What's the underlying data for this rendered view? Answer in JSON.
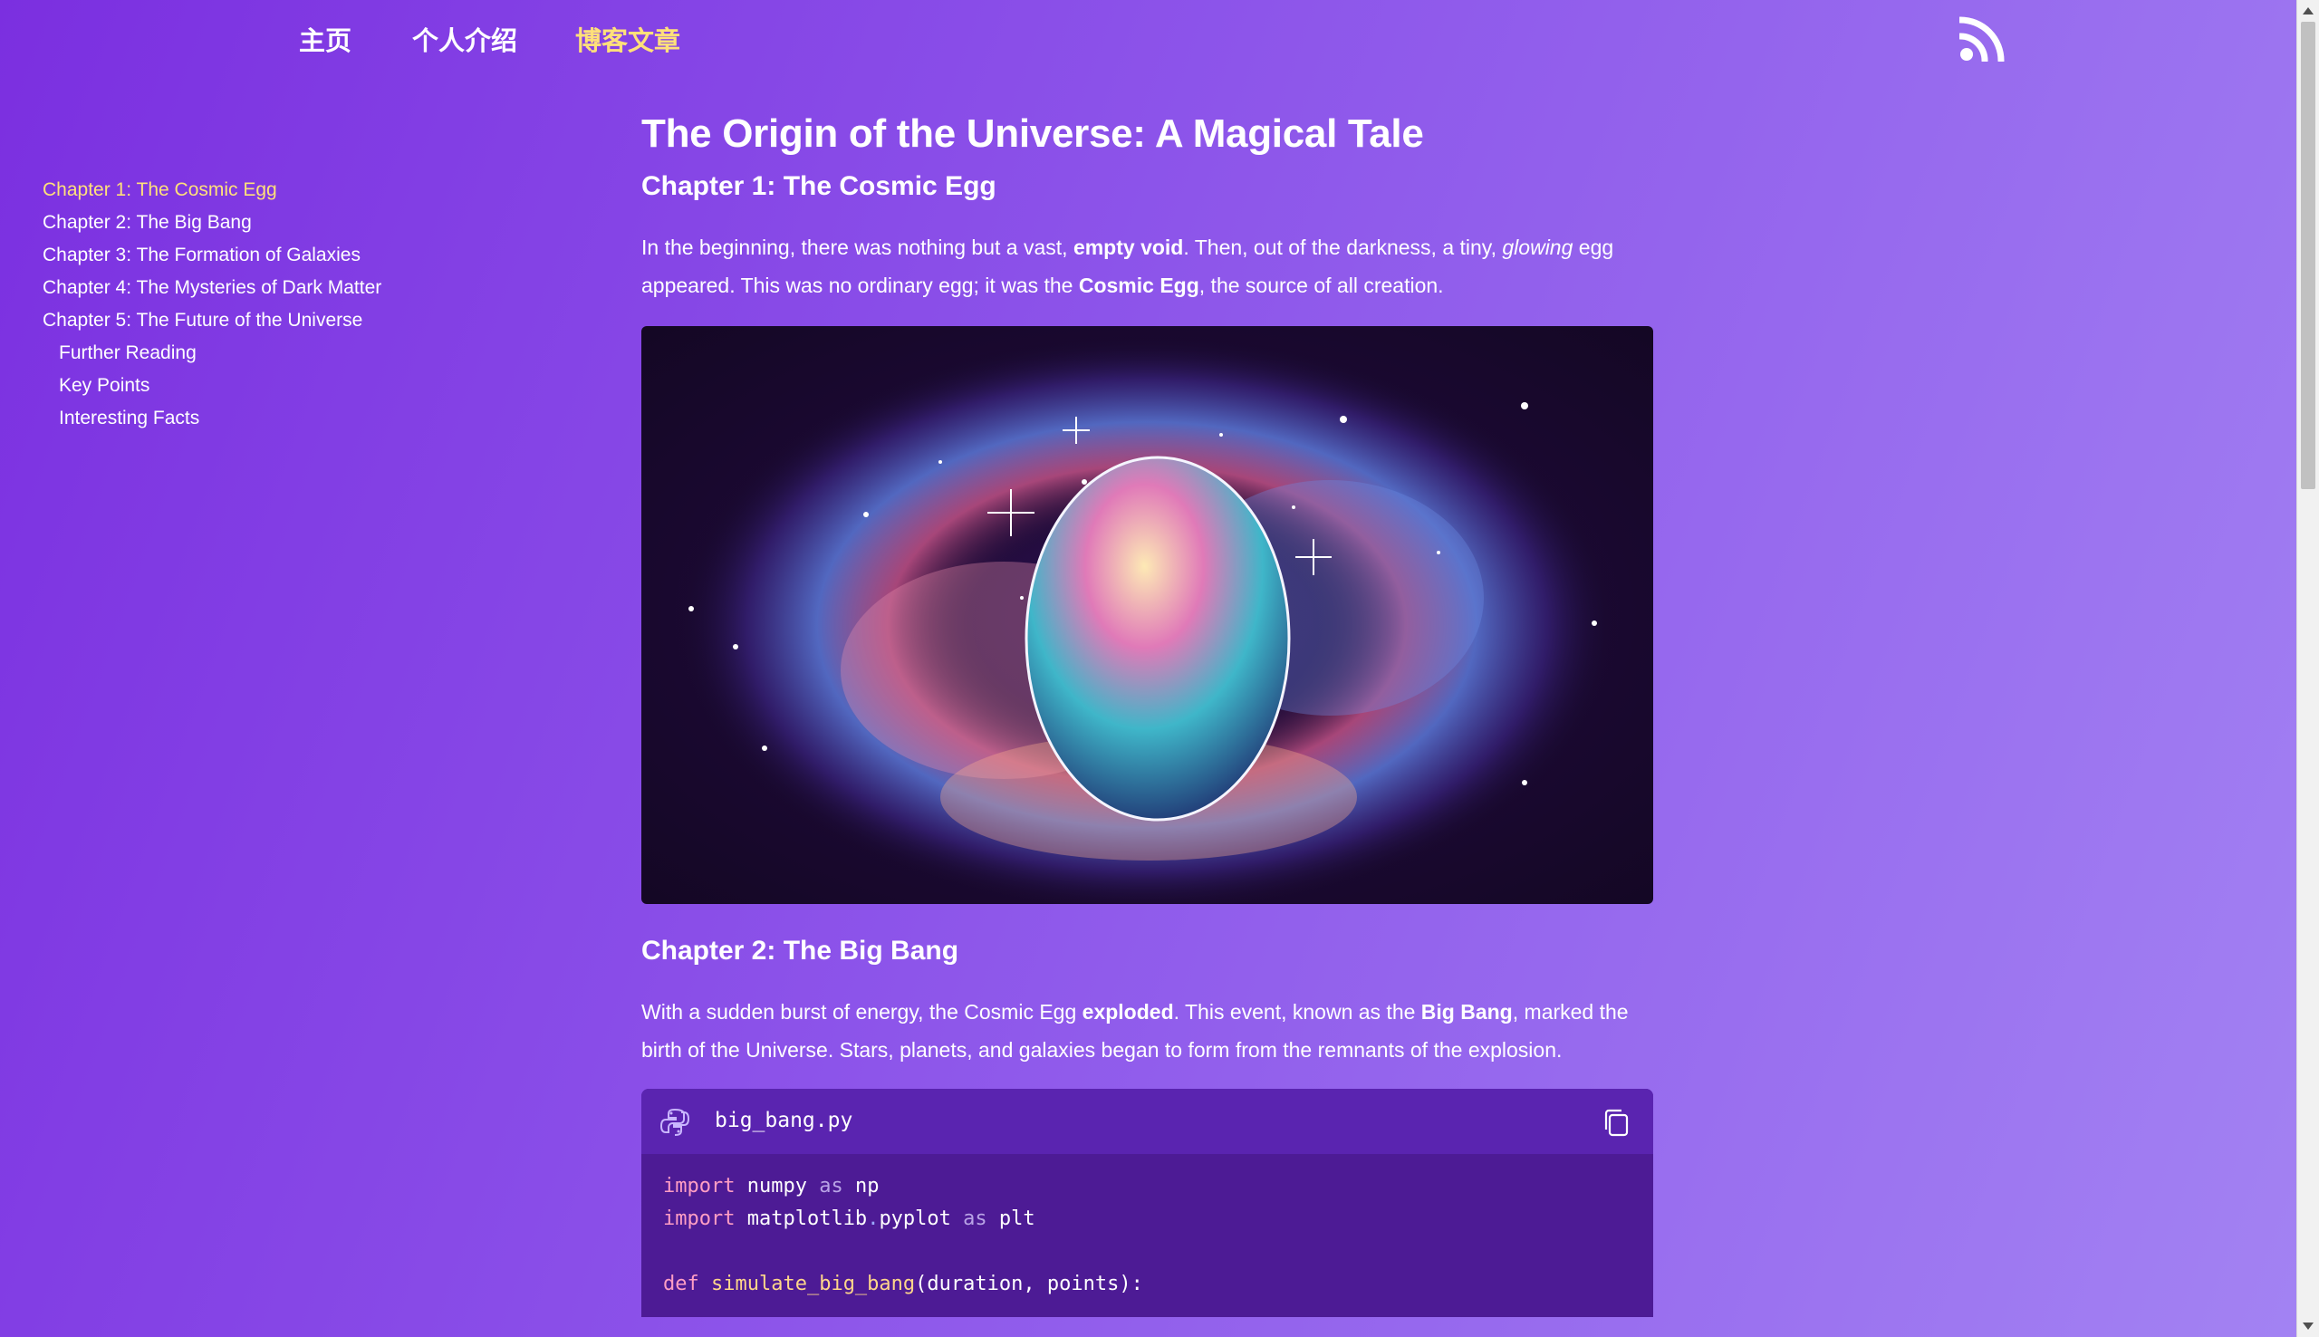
{
  "nav": {
    "items": [
      {
        "label": "主页",
        "active": false
      },
      {
        "label": "个人介绍",
        "active": false
      },
      {
        "label": "博客文章",
        "active": true
      }
    ],
    "rss_icon": "rss-icon"
  },
  "toc": {
    "items": [
      {
        "label": "Chapter 1: The Cosmic Egg",
        "active": true,
        "sub": false
      },
      {
        "label": "Chapter 2: The Big Bang",
        "active": false,
        "sub": false
      },
      {
        "label": "Chapter 3: The Formation of Galaxies",
        "active": false,
        "sub": false
      },
      {
        "label": "Chapter 4: The Mysteries of Dark Matter",
        "active": false,
        "sub": false
      },
      {
        "label": "Chapter 5: The Future of the Universe",
        "active": false,
        "sub": false
      },
      {
        "label": "Further Reading",
        "active": false,
        "sub": true
      },
      {
        "label": "Key Points",
        "active": false,
        "sub": true
      },
      {
        "label": "Interesting Facts",
        "active": false,
        "sub": true
      }
    ]
  },
  "article": {
    "title": "The Origin of the Universe: A Magical Tale",
    "ch1": {
      "heading": "Chapter 1: The Cosmic Egg",
      "p1_a": "In the beginning, there was nothing but a vast, ",
      "p1_b": "empty void",
      "p1_c": ". Then, out of the darkness, a tiny, ",
      "p1_d": "glowing",
      "p1_e": " egg appeared. This was no ordinary egg; it was the ",
      "p1_f": "Cosmic Egg",
      "p1_g": ", the source of all creation."
    },
    "ch2": {
      "heading": "Chapter 2: The Big Bang",
      "p1_a": "With a sudden burst of energy, the Cosmic Egg ",
      "p1_b": "exploded",
      "p1_c": ". This event, known as the ",
      "p1_d": "Big Bang",
      "p1_e": ", marked the birth of the Universe. Stars, planets, and galaxies began to form from the remnants of the explosion."
    },
    "code": {
      "filename": "big_bang.py",
      "lines": [
        {
          "kw": "import",
          "a": " numpy ",
          "kw2": "as",
          "b": " np"
        },
        {
          "kw": "import",
          "a": " matplotlib",
          "dot": ".",
          "c": "pyplot ",
          "kw2": "as",
          "b": " plt"
        },
        {
          "blank": true
        },
        {
          "kw": "def",
          "fn": " simulate_big_bang",
          "rest": "(duration, points):"
        }
      ]
    }
  },
  "colors": {
    "accent": "#ffe07a",
    "bg_start": "#7b2fe0",
    "bg_end": "#a383f3",
    "code_bg": "#4d1b95"
  }
}
